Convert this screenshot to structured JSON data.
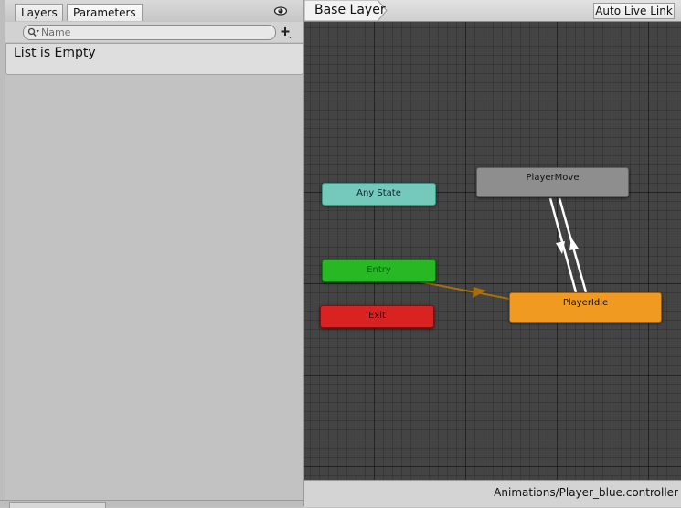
{
  "panel_tabs": [
    {
      "label": "Layers"
    },
    {
      "label": "Parameters",
      "active": true
    }
  ],
  "parameters": {
    "search_placeholder": "Name",
    "search_value": "",
    "empty_text": "List is Empty",
    "icons": {
      "eye": "eye-icon",
      "search": "search-icon",
      "add": "add-parameter-icon"
    }
  },
  "graph": {
    "breadcrumb": "Base Layer",
    "auto_live_link": "Auto Live Link",
    "states": {
      "any_state": {
        "label": "Any State",
        "color": "#74c9bb"
      },
      "entry": {
        "label": "Entry",
        "color": "#27b824"
      },
      "exit": {
        "label": "Exit",
        "color": "#d92222"
      },
      "player_move": {
        "label": "PlayerMove",
        "color": "#8e8e8e"
      },
      "player_idle": {
        "label": "PlayerIdle",
        "color": "#f09a21",
        "default": true
      }
    },
    "transitions": [
      {
        "from": "Entry",
        "to": "PlayerIdle",
        "color": "#a46f0c"
      },
      {
        "from": "PlayerMove",
        "to": "PlayerIdle",
        "color": "#ffffff"
      },
      {
        "from": "PlayerIdle",
        "to": "PlayerMove",
        "color": "#ffffff"
      }
    ],
    "background": "#444444"
  },
  "status": {
    "controller_path": "Animations/Player_blue.controller"
  }
}
